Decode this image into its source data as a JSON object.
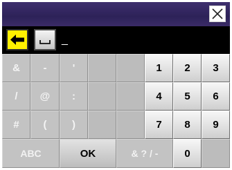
{
  "window": {
    "close_icon": "close-x-icon",
    "titlebar_color": "#2d2258"
  },
  "entry": {
    "backspace_icon": "left-arrow-icon",
    "space_icon": "space-bar-icon",
    "text": "_"
  },
  "keypad": {
    "symbol_keys": [
      "&",
      "-",
      "'",
      "/",
      "@",
      ":",
      "#",
      "(",
      ")"
    ],
    "number_keys": [
      "1",
      "2",
      "3",
      "4",
      "5",
      "6",
      "7",
      "8",
      "9",
      "0"
    ],
    "abc_label": "ABC",
    "ok_label": "OK",
    "symbols_mode_label": "& ? / -"
  }
}
